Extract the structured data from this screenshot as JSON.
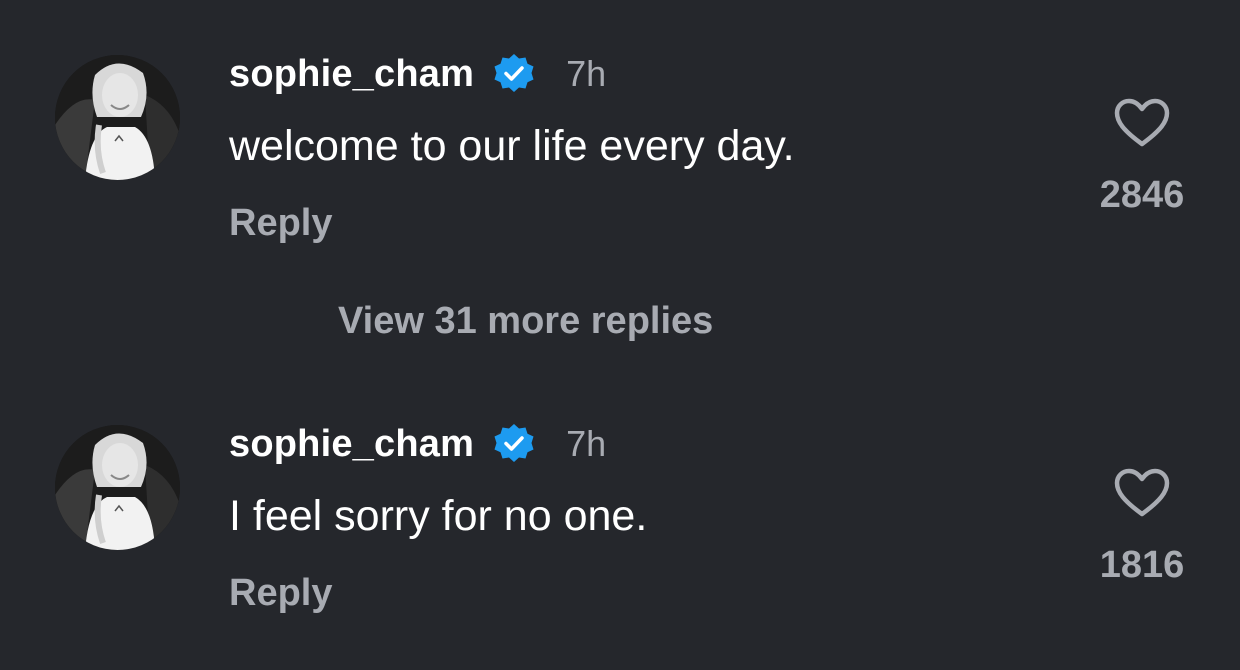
{
  "comments": [
    {
      "username": "sophie_cham",
      "verified": true,
      "timestamp": "7h",
      "text": "welcome to our life every day.",
      "reply_label": "Reply",
      "like_count": "2846"
    },
    {
      "username": "sophie_cham",
      "verified": true,
      "timestamp": "7h",
      "text": "I feel sorry for no one.",
      "reply_label": "Reply",
      "like_count": "1816"
    }
  ],
  "view_replies_label": "View 31 more replies",
  "icons": {
    "verified": "verified-badge-icon",
    "like": "heart-icon"
  },
  "colors": {
    "background": "#25272c",
    "primary_text": "#ffffff",
    "secondary_text": "#a8abb2",
    "verified_badge": "#1d9bf0"
  }
}
